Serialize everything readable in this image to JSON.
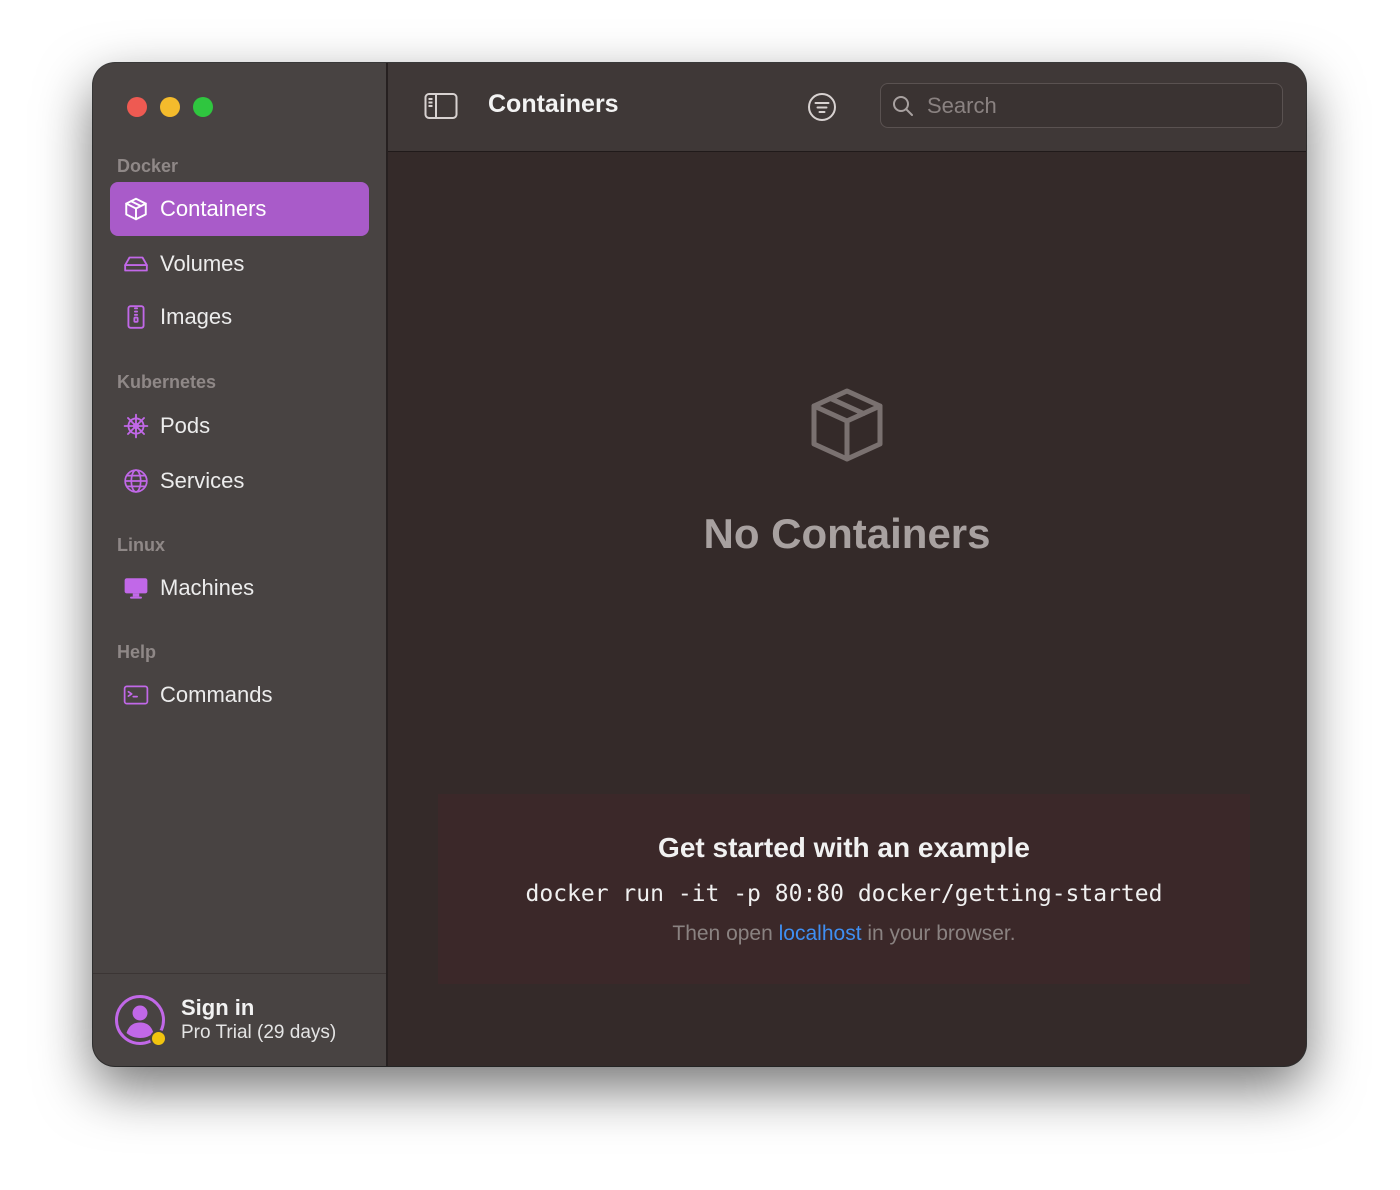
{
  "window": {
    "traffic_lights": [
      "close",
      "minimize",
      "zoom"
    ]
  },
  "sidebar": {
    "sections": [
      {
        "title": "Docker",
        "items": [
          {
            "label": "Containers",
            "icon": "cube-icon",
            "active": true
          },
          {
            "label": "Volumes",
            "icon": "drive-icon"
          },
          {
            "label": "Images",
            "icon": "archive-icon"
          }
        ]
      },
      {
        "title": "Kubernetes",
        "items": [
          {
            "label": "Pods",
            "icon": "helm-wheel-icon"
          },
          {
            "label": "Services",
            "icon": "globe-icon"
          }
        ]
      },
      {
        "title": "Linux",
        "items": [
          {
            "label": "Machines",
            "icon": "display-icon"
          }
        ]
      },
      {
        "title": "Help",
        "items": [
          {
            "label": "Commands",
            "icon": "terminal-icon"
          }
        ]
      }
    ],
    "footer": {
      "title": "Sign in",
      "subtitle": "Pro Trial (29 days)",
      "badge_color": "#f1c40f"
    }
  },
  "toolbar": {
    "title": "Containers",
    "search_placeholder": "Search"
  },
  "main": {
    "empty_title": "No Containers",
    "example": {
      "title": "Get started with an example",
      "command": "docker run -it -p 80:80 docker/getting-started",
      "hint_prefix": "Then open",
      "hint_link": "localhost",
      "hint_suffix": "in your browser."
    }
  },
  "colors": {
    "accent": "#a95bc9",
    "icon_purple": "#c168e8",
    "link": "#3f8ff2"
  }
}
